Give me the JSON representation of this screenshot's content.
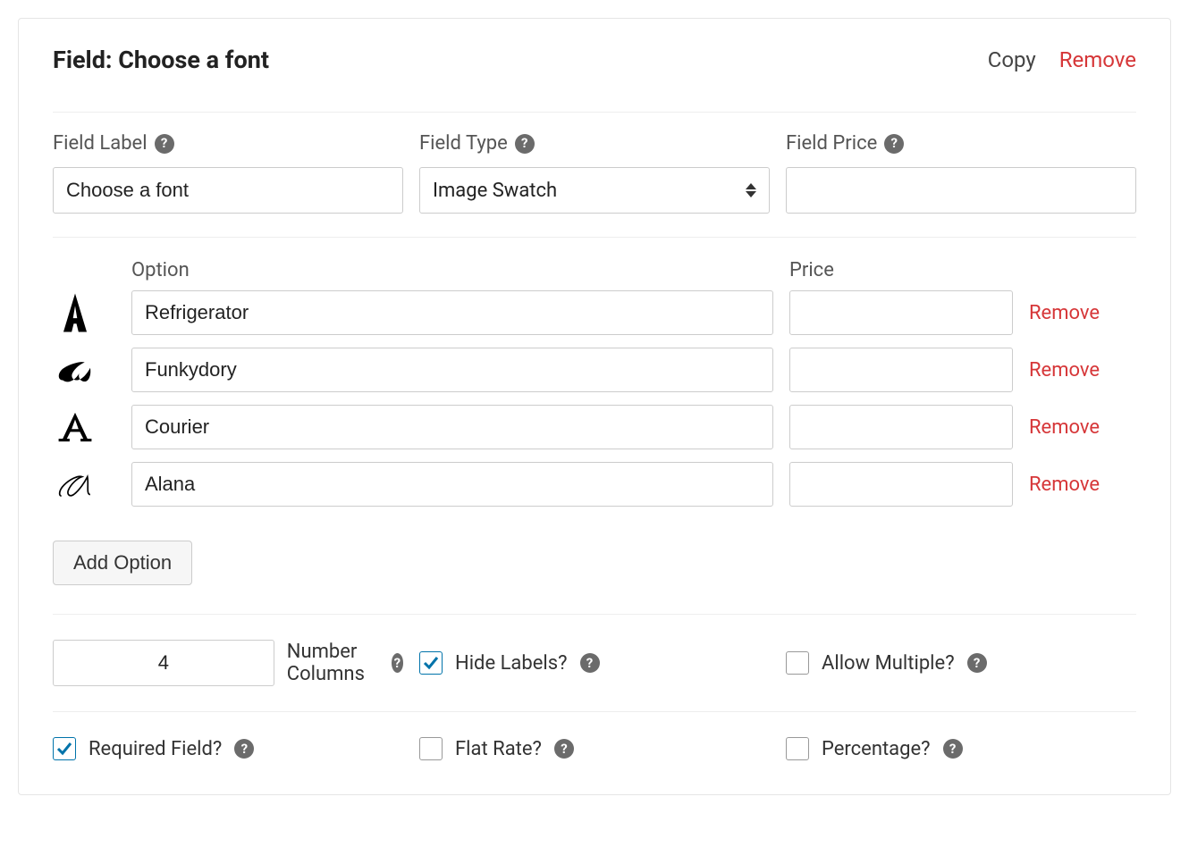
{
  "header": {
    "title_prefix": "Field: ",
    "title_name": "Choose a font",
    "copy_label": "Copy",
    "remove_label": "Remove"
  },
  "fields": {
    "label": {
      "label": "Field Label",
      "value": "Choose a font"
    },
    "type": {
      "label": "Field Type",
      "value": "Image Swatch"
    },
    "price": {
      "label": "Field Price",
      "value": ""
    }
  },
  "options": {
    "header_option": "Option",
    "header_price": "Price",
    "remove_label": "Remove",
    "add_label": "Add Option",
    "rows": [
      {
        "name": "Refrigerator",
        "price": "",
        "swatch": "a-condensed-bold"
      },
      {
        "name": "Funkydory",
        "price": "",
        "swatch": "a-script-fancy"
      },
      {
        "name": "Courier",
        "price": "",
        "swatch": "a-serif"
      },
      {
        "name": "Alana",
        "price": "",
        "swatch": "a-cursive-thin"
      }
    ]
  },
  "settings": {
    "columns": {
      "label": "Number Columns",
      "value": "4"
    },
    "hide": {
      "label": "Hide Labels?",
      "checked": true
    },
    "multiple": {
      "label": "Allow Multiple?",
      "checked": false
    },
    "required": {
      "label": "Required Field?",
      "checked": true
    },
    "flat": {
      "label": "Flat Rate?",
      "checked": false
    },
    "percent": {
      "label": "Percentage?",
      "checked": false
    }
  }
}
